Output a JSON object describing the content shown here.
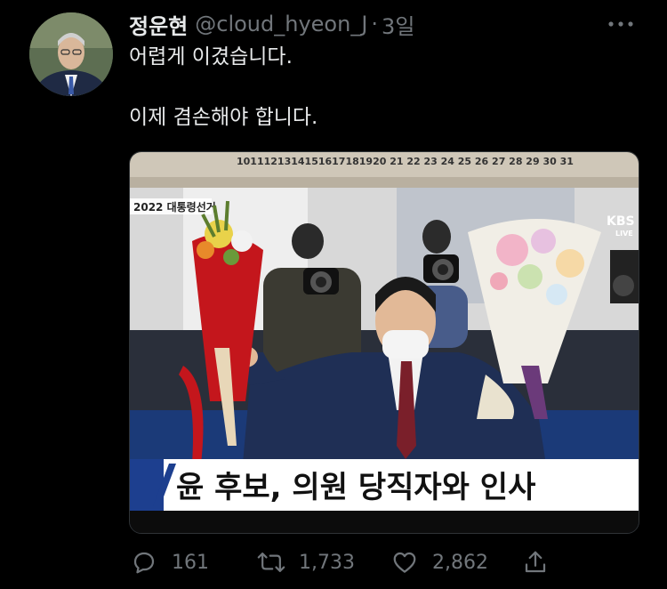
{
  "tweet": {
    "author_name": "정운현",
    "author_handle": "@cloud_hyeon_J",
    "separator": "·",
    "time": "3일",
    "line1": "어렵게 이겼습니다.",
    "line2": "이제 겸손해야 합니다."
  },
  "media": {
    "calendar_numbers": "1011121314151617181920 21 22 23 24 25 26 27 28 29 30 31",
    "broadcast_tag": "2022 대통령선거",
    "channel_logo": "KBS",
    "channel_sub": "LIVE",
    "ticker": "윤 후보, 의원 당직자와 인사"
  },
  "actions": {
    "reply_count": "161",
    "retweet_count": "1,733",
    "like_count": "2,862"
  },
  "colors": {
    "background": "#000000",
    "text": "#e7e9ea",
    "muted": "#71767b",
    "ticker_blue": "#1d3f8f"
  },
  "icons": {
    "more": "more-icon",
    "reply": "reply-icon",
    "retweet": "retweet-icon",
    "like": "heart-icon",
    "share": "share-icon"
  }
}
